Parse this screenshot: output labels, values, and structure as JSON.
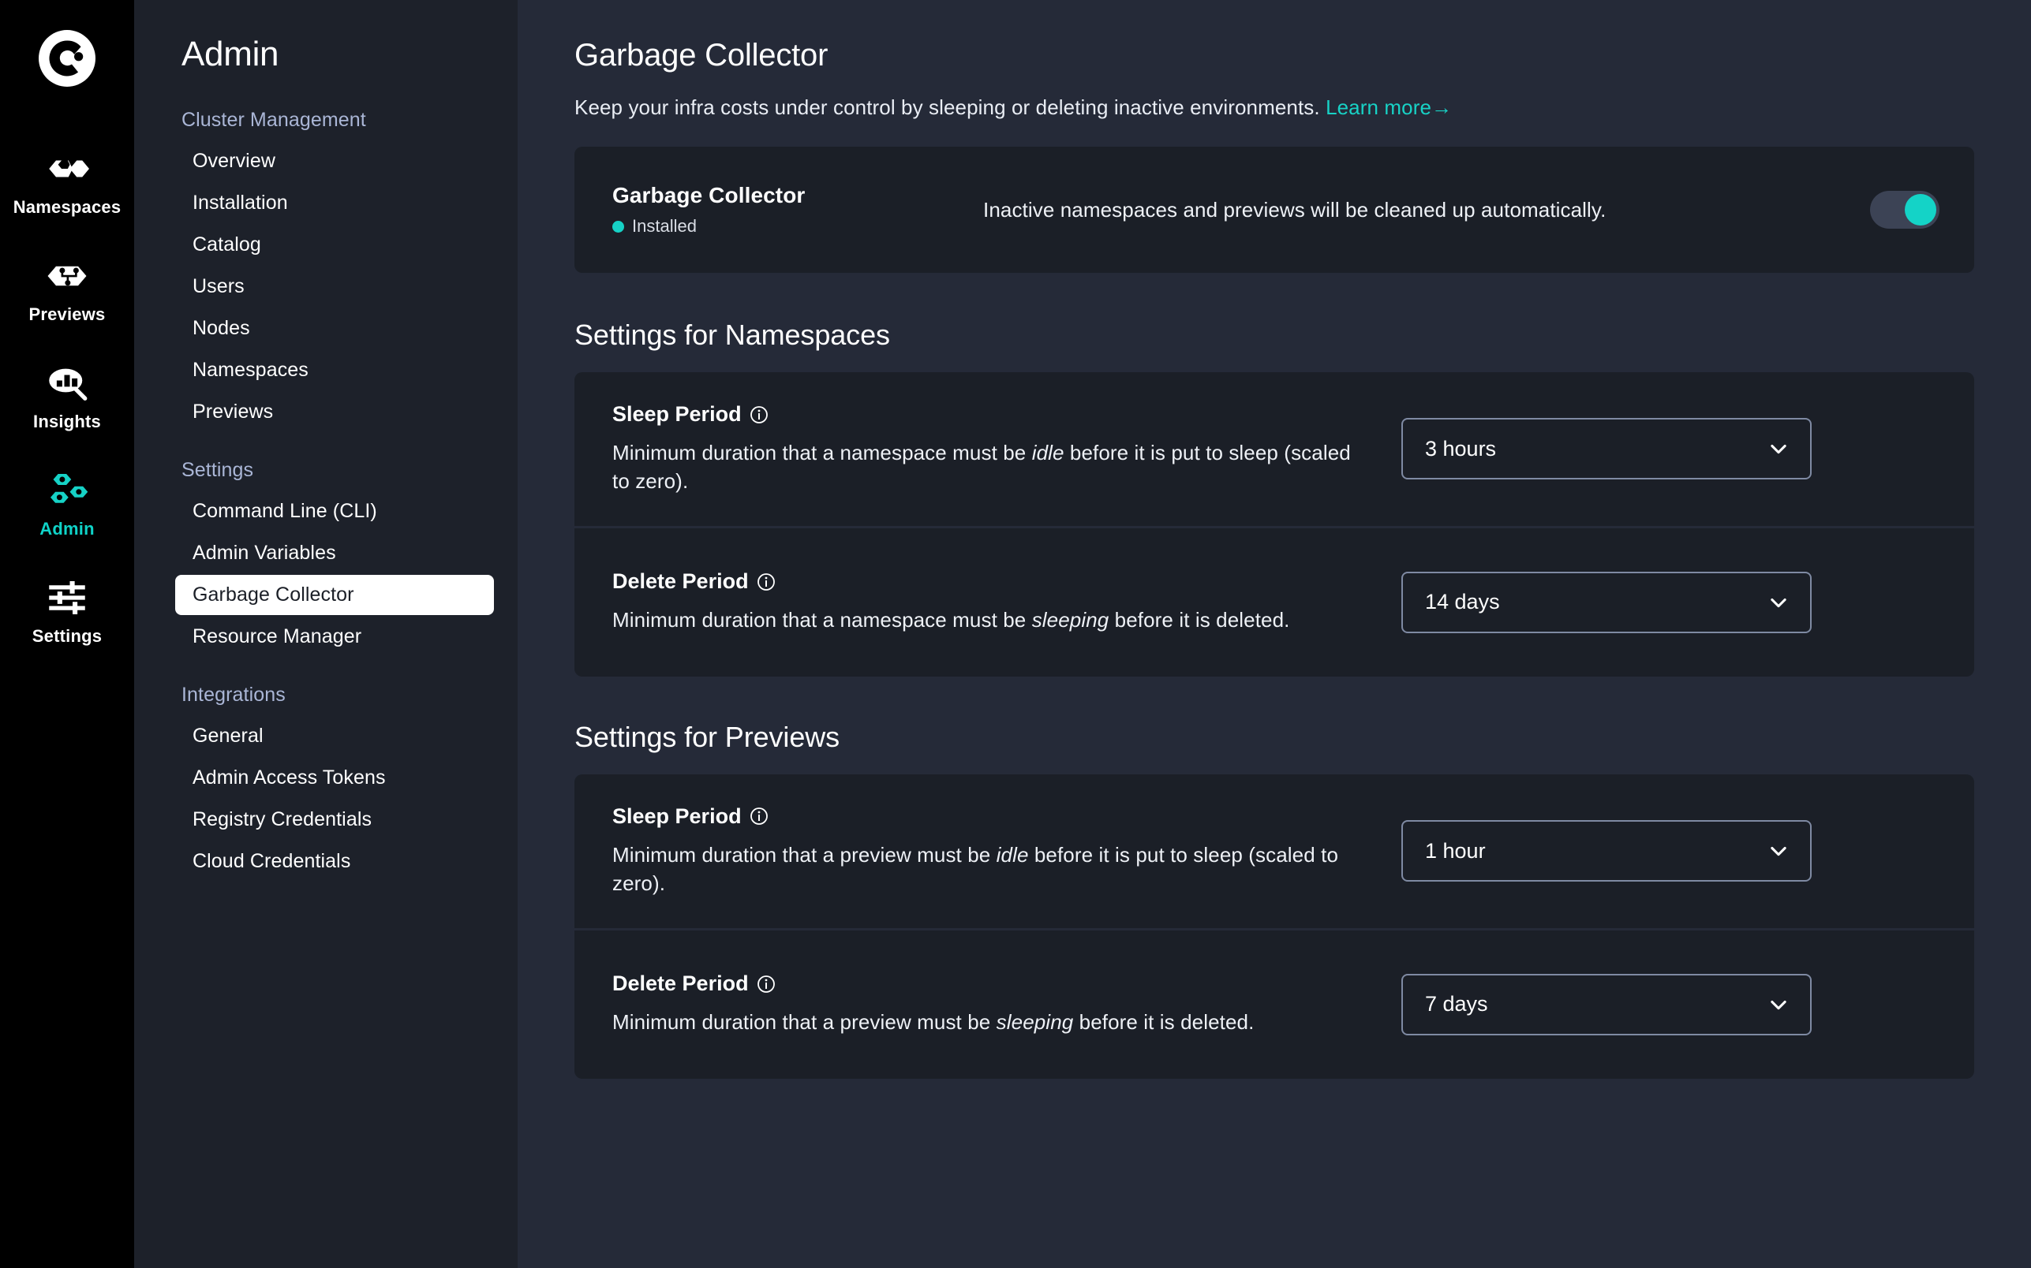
{
  "rail": {
    "logo_icon": "loft-logo-icon",
    "items": [
      {
        "label": "Namespaces",
        "icon": "namespaces-icon",
        "active": false
      },
      {
        "label": "Previews",
        "icon": "previews-icon",
        "active": false
      },
      {
        "label": "Insights",
        "icon": "insights-icon",
        "active": false
      },
      {
        "label": "Admin",
        "icon": "admin-icon",
        "active": true
      },
      {
        "label": "Settings",
        "icon": "settings-icon",
        "active": false
      }
    ]
  },
  "sidebar": {
    "title": "Admin",
    "groups": [
      {
        "label": "Cluster Management",
        "items": [
          {
            "label": "Overview",
            "active": false
          },
          {
            "label": "Installation",
            "active": false
          },
          {
            "label": "Catalog",
            "active": false
          },
          {
            "label": "Users",
            "active": false
          },
          {
            "label": "Nodes",
            "active": false
          },
          {
            "label": "Namespaces",
            "active": false
          },
          {
            "label": "Previews",
            "active": false
          }
        ]
      },
      {
        "label": "Settings",
        "items": [
          {
            "label": "Command Line (CLI)",
            "active": false
          },
          {
            "label": "Admin Variables",
            "active": false
          },
          {
            "label": "Garbage Collector",
            "active": true
          },
          {
            "label": "Resource Manager",
            "active": false
          }
        ]
      },
      {
        "label": "Integrations",
        "items": [
          {
            "label": "General",
            "active": false
          },
          {
            "label": "Admin Access Tokens",
            "active": false
          },
          {
            "label": "Registry Credentials",
            "active": false
          },
          {
            "label": "Cloud Credentials",
            "active": false
          }
        ]
      }
    ]
  },
  "main": {
    "title": "Garbage Collector",
    "subtitle": "Keep your infra costs under control by sleeping or deleting inactive environments.",
    "learn_more": "Learn more",
    "learn_more_arrow": "→",
    "status_card": {
      "name": "Garbage Collector",
      "badge": "Installed",
      "description": "Inactive namespaces and previews will be cleaned up automatically.",
      "toggle_on": true,
      "toggle_name": "garbage-collector-toggle"
    },
    "sections": [
      {
        "title": "Settings for Namespaces",
        "rows": [
          {
            "label": "Sleep Period",
            "info_icon": "info-icon",
            "desc_pre": "Minimum duration that a namespace must be ",
            "desc_em": "idle",
            "desc_post": " before it is put to sleep (scaled to zero).",
            "select_value": "3 hours"
          },
          {
            "label": "Delete Period",
            "info_icon": "info-icon",
            "desc_pre": "Minimum duration that a namespace must be ",
            "desc_em": "sleeping",
            "desc_post": " before it is deleted.",
            "select_value": "14 days"
          }
        ]
      },
      {
        "title": "Settings for Previews",
        "rows": [
          {
            "label": "Sleep Period",
            "info_icon": "info-icon",
            "desc_pre": "Minimum duration that a preview must be ",
            "desc_em": "idle",
            "desc_post": " before it is put to sleep (scaled to zero).",
            "select_value": "1 hour"
          },
          {
            "label": "Delete Period",
            "info_icon": "info-icon",
            "desc_pre": "Minimum duration that a preview must be ",
            "desc_em": "sleeping",
            "desc_post": " before it is deleted.",
            "select_value": "7 days"
          }
        ]
      }
    ]
  },
  "colors": {
    "accent": "#16d2c6",
    "rail_bg": "#000000",
    "sidebar_bg": "#1d212a",
    "main_bg": "#252a38",
    "card_bg": "#1b1f27",
    "group_label": "#aab6d6"
  }
}
